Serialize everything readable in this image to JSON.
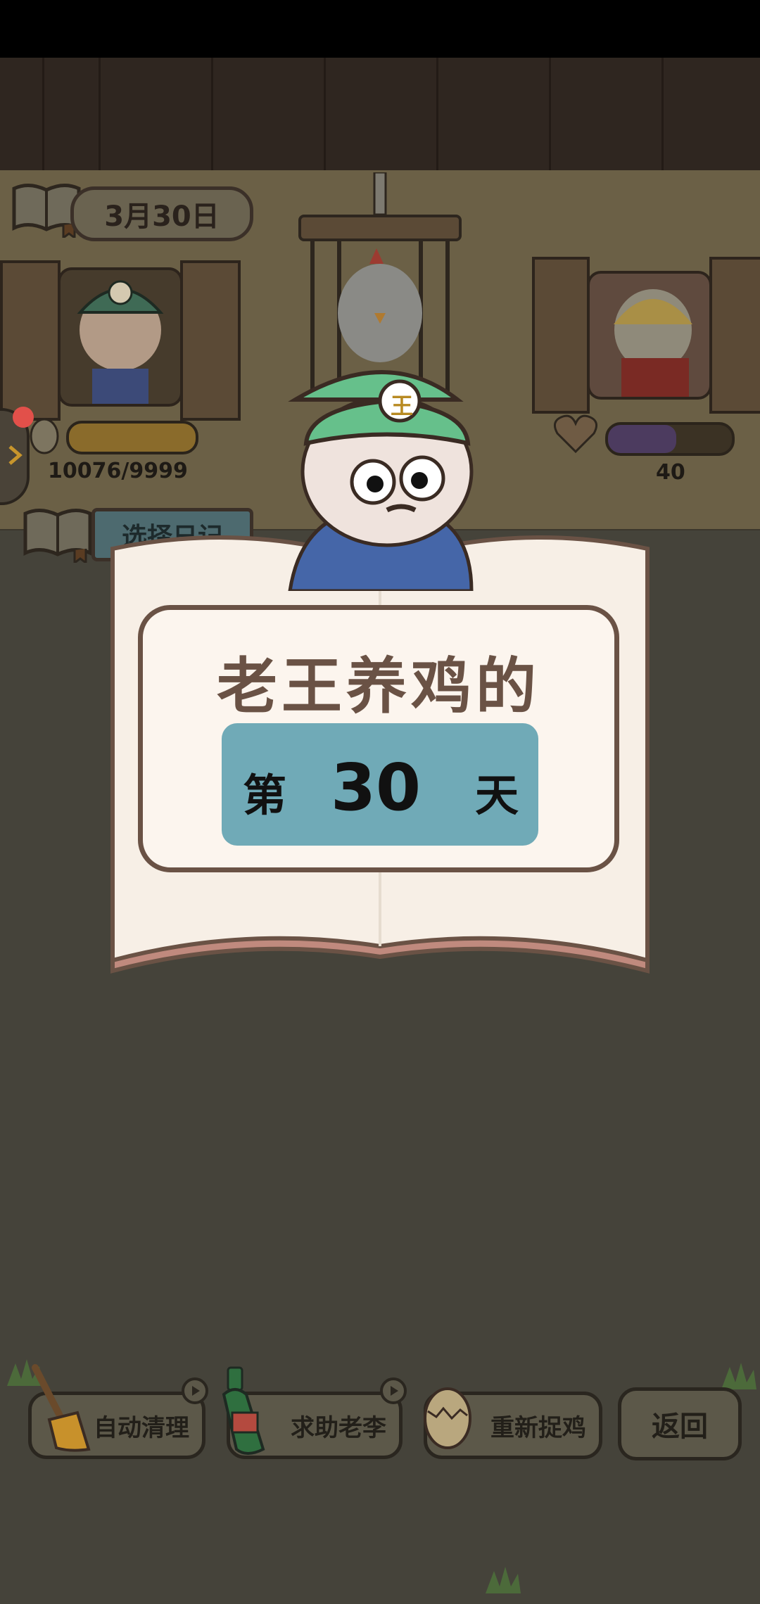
{
  "header": {
    "date_label": "3月30日",
    "diary_button_label": "选择日记"
  },
  "stats": {
    "left_counter": "10076/9999",
    "left_progress": 1.0,
    "right_counter": "40",
    "right_progress": 0.55
  },
  "dialog": {
    "headline": "老王养鸡的",
    "day_prefix": "第",
    "day_number": "30",
    "day_suffix": "天"
  },
  "actions": [
    {
      "label": "自动清理",
      "icon": "broom-icon",
      "ad": true
    },
    {
      "label": "求助老李",
      "icon": "bottle-icon",
      "ad": true
    },
    {
      "label": "重新捉鸡",
      "icon": "egg-icon",
      "ad": false
    },
    {
      "label": "返回",
      "icon": "",
      "ad": false
    }
  ],
  "colors": {
    "accent_teal": "#70aab7",
    "panel_bg": "#fcf5ee",
    "panel_border": "#6a5245",
    "overlay_bg": "#45433a"
  }
}
